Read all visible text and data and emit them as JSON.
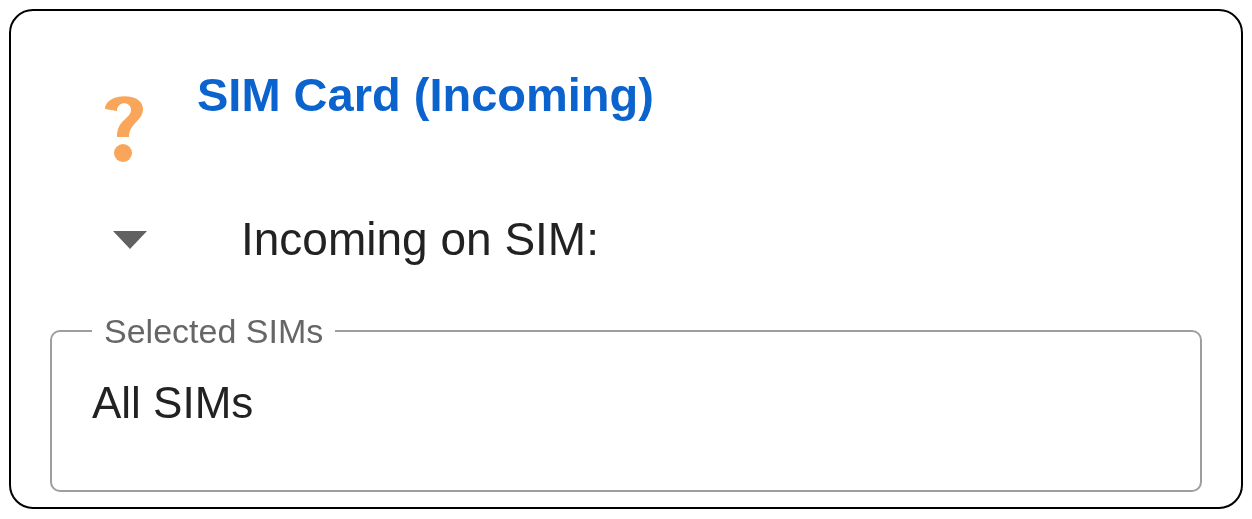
{
  "card": {
    "title": "SIM Card (Incoming)",
    "section": {
      "label": "Incoming on SIM:",
      "expanded": true
    },
    "field": {
      "label": "Selected SIMs",
      "value": "All SIMs"
    }
  }
}
